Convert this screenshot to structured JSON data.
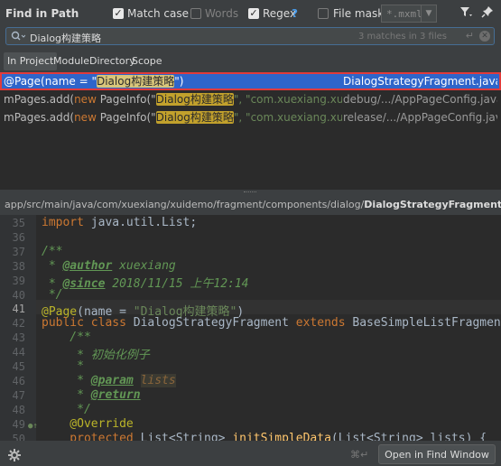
{
  "header": {
    "title": "Find in Path",
    "options": {
      "match_case": {
        "label": "Match case",
        "checked": true
      },
      "words": {
        "label": "Words",
        "checked": false
      },
      "regex": {
        "label": "Regex",
        "checked": true,
        "help": "?"
      },
      "file_mask": {
        "label": "File mask:",
        "checked": false,
        "value": "*.mxml"
      }
    }
  },
  "search": {
    "query": "Dialog构建策略",
    "match_count": "3 matches in 3 files"
  },
  "tabs": [
    {
      "label": "In Project",
      "active": true
    },
    {
      "label": "Module",
      "active": false
    },
    {
      "label": "Directory",
      "active": false
    },
    {
      "label": "Scope",
      "active": false
    }
  ],
  "results": [
    {
      "prefix": "@Page(name = \"",
      "match": "Dialog构建策略",
      "suffix": "\")",
      "file": "DialogStrategyFragment.java 41",
      "selected": true
    },
    {
      "prefix": "mPages.add(",
      "kw": "new",
      "mid": " PageInfo(\"",
      "match": "Dialog构建策略",
      "suffix": "\", \"com.xuexiang.xuidemo.fragme",
      "file": "debug/.../AppPageConfig.java 250",
      "selected": false
    },
    {
      "prefix": "mPages.add(",
      "kw": "new",
      "mid": " PageInfo(\"",
      "match": "Dialog构建策略",
      "suffix": "\", \"com.xuexiang.xuidemo.fragme",
      "file": "release/.../AppPageConfig.java 246",
      "selected": false
    }
  ],
  "path": {
    "dir": "app/src/main/java/com/xuexiang/xuidemo/fragment/components/dialog/",
    "file": "DialogStrategyFragment.java"
  },
  "editor": {
    "lines": [
      "35",
      "36",
      "37",
      "38",
      "39",
      "40",
      "41",
      "42",
      "43",
      "44",
      "45",
      "46",
      "47",
      "48",
      "49",
      "50"
    ],
    "current_line": "41",
    "code": {
      "l35": [
        "import",
        " java.util.List;"
      ],
      "l37": "/**",
      "l38": [
        " * ",
        "@author",
        " xuexiang"
      ],
      "l39": [
        " * ",
        "@since",
        " 2018/11/15 上午12:14"
      ],
      "l40": " */",
      "l41": [
        "@Page",
        "(name = ",
        "\"Dialog构建策略\"",
        ")"
      ],
      "l42": [
        "public class",
        " DialogStrategyFragment ",
        "extends",
        " BaseSimpleListFragment"
      ],
      "l43": "    /**",
      "l44": "     * 初始化例子",
      "l45": "     *",
      "l46": [
        "     * ",
        "@param",
        " ",
        "lists"
      ],
      "l47": [
        "     * ",
        "@return"
      ],
      "l48": "     */",
      "l49": "    @Override",
      "l50": [
        "    protected",
        " List<String> ",
        "initSimpleData",
        "(List<String> lists) {"
      ]
    }
  },
  "footer": {
    "shortcut": "⌘↵",
    "open_button": "Open in Find Window"
  },
  "colors": {
    "accent": "#2f65ca",
    "selection_border": "#e03b3b",
    "highlight": "#c2a12c"
  }
}
